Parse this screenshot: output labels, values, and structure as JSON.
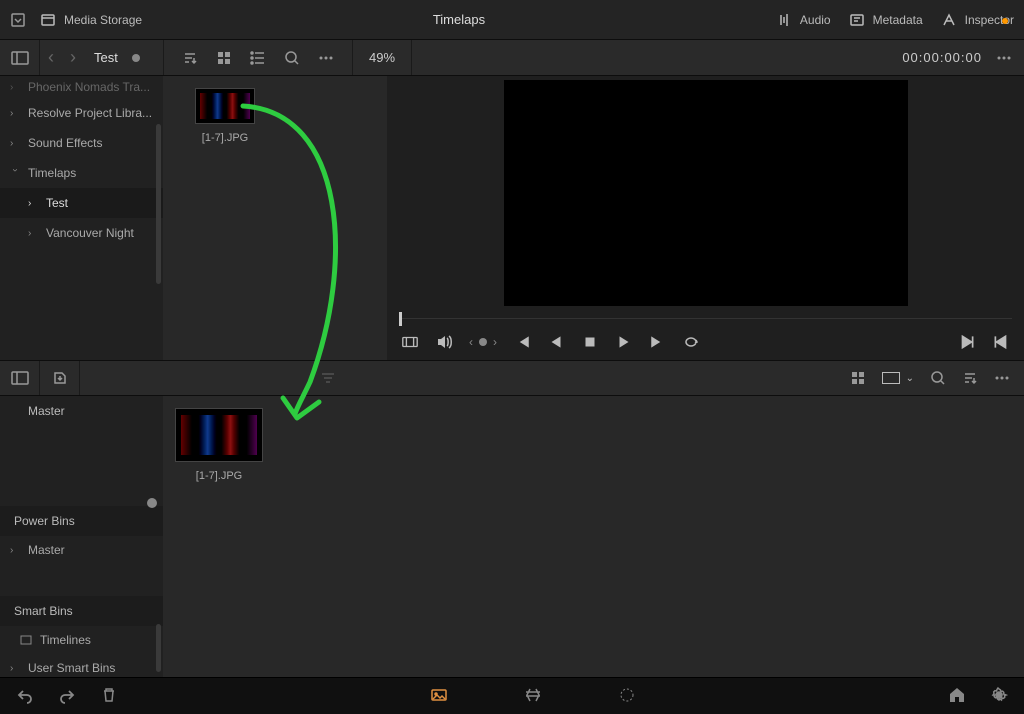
{
  "header": {
    "storage_label": "Media Storage",
    "title": "Timelaps",
    "audio": "Audio",
    "metadata": "Metadata",
    "inspector": "Inspector"
  },
  "toolbar": {
    "breadcrumb": "Test",
    "zoom": "49%",
    "timecode": "00:00:00:00"
  },
  "tree": {
    "item0": "Phoenix Nomads Tra...",
    "item1": "Resolve Project Libra...",
    "item2": "Sound Effects",
    "item3": "Timelaps",
    "item4": "Test",
    "item5": "Vancouver Night"
  },
  "clip1": {
    "label": "[1-7].JPG"
  },
  "clip2": {
    "label": "[1-7].JPG"
  },
  "pool": {
    "master": "Master",
    "power": "Power Bins",
    "power_master": "Master",
    "smart": "Smart Bins",
    "timelines": "Timelines",
    "user_smart": "User Smart Bins"
  }
}
